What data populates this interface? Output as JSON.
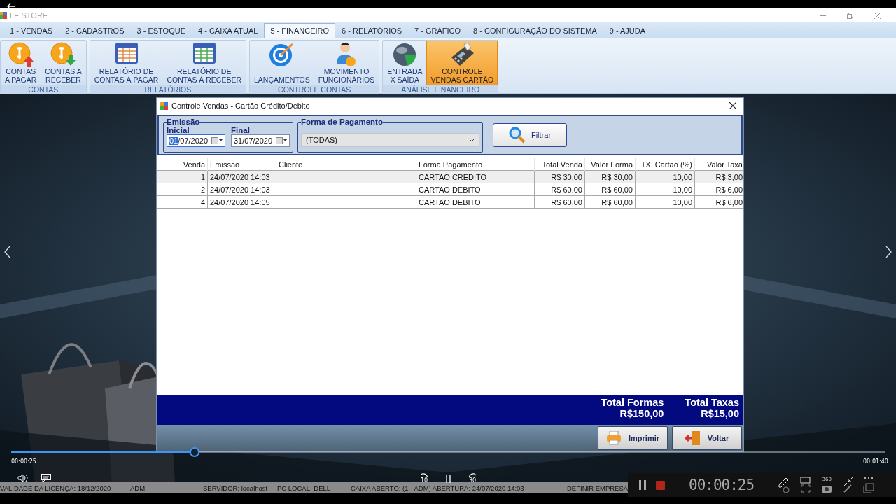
{
  "window": {
    "title": "LE STORE"
  },
  "menu_tabs": [
    {
      "label": "1 - VENDAS",
      "selected": false
    },
    {
      "label": "2 - CADASTROS",
      "selected": false
    },
    {
      "label": "3 - ESTOQUE",
      "selected": false
    },
    {
      "label": "4 - CAIXA ATUAL",
      "selected": false
    },
    {
      "label": "5 - FINANCEIRO",
      "selected": true
    },
    {
      "label": "6 - RELATÓRIOS",
      "selected": false
    },
    {
      "label": "7 - GRÁFICO",
      "selected": false
    },
    {
      "label": "8 - CONFIGURAÇÃO DO SISTEMA",
      "selected": false
    },
    {
      "label": "9 - AJUDA",
      "selected": false
    }
  ],
  "ribbon_groups": [
    {
      "label": "CONTAS",
      "buttons": [
        {
          "label": "CONTAS\nA PAGAR",
          "selected": false
        },
        {
          "label": "CONTAS A\nRECEBER",
          "selected": false
        }
      ]
    },
    {
      "label": "RELATÓRIOS",
      "buttons": [
        {
          "label": "RELATÓRIO DE\nCONTAS À PAGAR",
          "selected": false
        },
        {
          "label": "RELATÓRIO DE\nCONTAS À RECEBER",
          "selected": false
        }
      ]
    },
    {
      "label": "CONTROLE CONTAS",
      "buttons": [
        {
          "label": "LANÇAMENTOS",
          "selected": false
        },
        {
          "label": "MOVIMENTO\nFUNCIONÁRIOS",
          "selected": false
        }
      ]
    },
    {
      "label": "ANÁLISE FINANCEIRO",
      "buttons": [
        {
          "label": "ENTRADA\nX SAÍDA",
          "selected": false
        },
        {
          "label": "CONTROLE\nVENDAS CARTÃO",
          "selected": true
        }
      ]
    }
  ],
  "dialog": {
    "title": "Controle Vendas - Cartão Crédito/Debito",
    "emissao": {
      "legend": "Emissão",
      "initial_label": "Inicial",
      "initial_value": "01/07/2020",
      "final_label": "Final",
      "final_value": "31/07/2020"
    },
    "payment": {
      "legend": "Forma de Pagamento",
      "value": "(TODAS)"
    },
    "filter_button": "Filtrar",
    "table": {
      "columns": [
        {
          "label": "Venda",
          "kind": "number"
        },
        {
          "label": "Emissão",
          "kind": "text"
        },
        {
          "label": "Cliente",
          "kind": "text"
        },
        {
          "label": "Forma Pagamento",
          "kind": "text"
        },
        {
          "label": "Total Venda",
          "kind": "number"
        },
        {
          "label": "Valor Forma",
          "kind": "number"
        },
        {
          "label": "TX. Cartão (%)",
          "kind": "number"
        },
        {
          "label": "Valor Taxa",
          "kind": "number"
        }
      ],
      "rows": [
        {
          "selected": true,
          "cells": [
            "1",
            "24/07/2020 14:03",
            "",
            "CARTAO CREDITO",
            "R$ 30,00",
            "R$ 30,00",
            "10,00",
            "R$ 3,00"
          ]
        },
        {
          "selected": false,
          "cells": [
            "2",
            "24/07/2020 14:03",
            "",
            "CARTAO DEBITO",
            "R$ 60,00",
            "R$ 60,00",
            "10,00",
            "R$ 6,00"
          ]
        },
        {
          "selected": false,
          "cells": [
            "4",
            "24/07/2020 14:05",
            "",
            "CARTAO DEBITO",
            "R$ 60,00",
            "R$ 60,00",
            "10,00",
            "R$ 6,00"
          ]
        }
      ]
    },
    "totals": [
      {
        "label": "Total Formas",
        "value": "R$150,00"
      },
      {
        "label": "Total Taxas",
        "value": "R$15,00"
      }
    ],
    "buttons": [
      "Imprimir",
      "Voltar"
    ]
  },
  "player": {
    "elapsed": "00:00:25",
    "duration": "00:01:40",
    "level": 0.21,
    "skip_back": "10",
    "skip_forward": "30",
    "recorder_timer": "00:00:25",
    "recorder_badge": "360"
  },
  "status_bar": [
    "VALIDADE DA LICENÇA: 18/12/2020",
    "ADM",
    "SERVIDOR: localhost",
    "PC LOCAL: DELL",
    "CAIXA ABERTO: (1 - ADM) ABERTURA: 24/07/2020 14:03",
    "DEFINIR EMPRESA"
  ]
}
